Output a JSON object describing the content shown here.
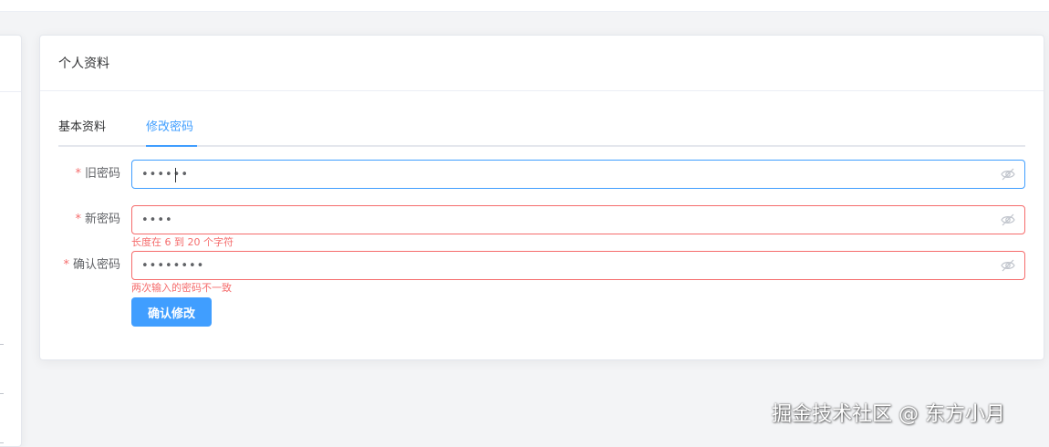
{
  "card": {
    "title": "个人资料"
  },
  "tabs": [
    {
      "label": "基本资料",
      "active": false
    },
    {
      "label": "修改密码",
      "active": true
    }
  ],
  "form": {
    "fields": [
      {
        "label": "旧密码",
        "required": true,
        "value": "••••••",
        "state": "focused",
        "error": "",
        "icon": "eye-icon"
      },
      {
        "label": "新密码",
        "required": true,
        "value": "••••",
        "state": "error",
        "error": "长度在 6 到 20 个字符",
        "icon": "eye-icon"
      },
      {
        "label": "确认密码",
        "required": true,
        "value": "••••••••",
        "state": "error",
        "error": "两次输入的密码不一致",
        "icon": "eye-icon"
      }
    ],
    "required_mark": "*",
    "submit_label": "确认修改"
  },
  "watermark": "掘金技术社区 @ 东方小月",
  "colors": {
    "primary": "#409eff",
    "error": "#f56c6c",
    "border": "#dcdfe6",
    "background": "#f3f4f6"
  }
}
